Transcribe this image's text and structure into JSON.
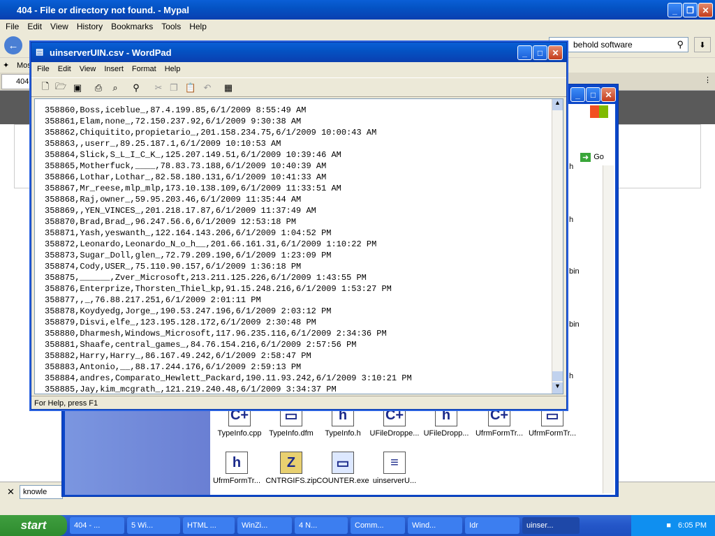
{
  "firefox": {
    "title": "404 - File or directory not found. - Mypal",
    "menu": [
      "File",
      "Edit",
      "View",
      "History",
      "Bookmarks",
      "Tools",
      "Help"
    ],
    "search_value": "behold software",
    "bookmarks_item": "Most",
    "tab_label": "404",
    "find_value": "knowle"
  },
  "explorer": {
    "go_label": "Go",
    "side_labels": [
      "r.h",
      "h",
      "bin",
      "bin",
      "h"
    ],
    "files": [
      {
        "name": "TypeInfo.cpp",
        "icon": "C+"
      },
      {
        "name": "TypeInfo.dfm",
        "icon": "▭"
      },
      {
        "name": "TypeInfo.h",
        "icon": "h"
      },
      {
        "name": "UFileDroppe...",
        "icon": "C+"
      },
      {
        "name": "UFileDropp...",
        "icon": "h"
      },
      {
        "name": "UfrmFormTr...",
        "icon": "C+"
      },
      {
        "name": "UfrmFormTr...",
        "icon": "▭"
      },
      {
        "name": "UfrmFormTr...",
        "icon": "h"
      },
      {
        "name": "CNTRGIFS.zip",
        "icon": "Z"
      },
      {
        "name": "COUNTER.exe",
        "icon": "▭"
      },
      {
        "name": "uinserverU...",
        "icon": "≡"
      }
    ]
  },
  "wordpad": {
    "title": "uinserverUIN.csv - WordPad",
    "menu": [
      "File",
      "Edit",
      "View",
      "Insert",
      "Format",
      "Help"
    ],
    "status": "For Help, press F1",
    "lines": [
      "358860,Boss,iceblue_,87.4.199.85,6/1/2009 8:55:49 AM",
      "358861,Elam,none_,72.150.237.92,6/1/2009 9:30:38 AM",
      "358862,Chiquitito,propietario_,201.158.234.75,6/1/2009 10:00:43 AM",
      "358863,,userr_,89.25.187.1,6/1/2009 10:10:53 AM",
      "358864,Slick,S_L_I_C_K_,125.207.149.51,6/1/2009 10:39:46 AM",
      "358865,Motherfuck,____,78.83.73.188,6/1/2009 10:40:39 AM",
      "358866,Lothar,Lothar_,82.58.180.131,6/1/2009 10:41:33 AM",
      "358867,Mr_reese,mlp_mlp,173.10.138.109,6/1/2009 11:33:51 AM",
      "358868,Raj,owner_,59.95.203.46,6/1/2009 11:35:44 AM",
      "358869,,YEN_VINCES_,201.218.17.87,6/1/2009 11:37:49 AM",
      "358870,Brad,Brad_,96.247.56.6,6/1/2009 12:53:18 PM",
      "358871,Yash,yeswanth_,122.164.143.206,6/1/2009 1:04:52 PM",
      "358872,Leonardo,Leonardo_N_o_h__,201.66.161.31,6/1/2009 1:10:22 PM",
      "358873,Sugar_Doll,glen_,72.79.209.190,6/1/2009 1:23:09 PM",
      "358874,Cody,USER_,75.110.90.157,6/1/2009 1:36:18 PM",
      "358875,______,Zver_Microsoft,213.211.125.226,6/1/2009 1:43:55 PM",
      "358876,Enterprize,Thorsten_Thiel_kp,91.15.248.216,6/1/2009 1:53:27 PM",
      "358877,,_,76.88.217.251,6/1/2009 2:01:11 PM",
      "358878,Koydyedg,Jorge_,190.53.247.196,6/1/2009 2:03:12 PM",
      "358879,Disvi,elfe_,123.195.128.172,6/1/2009 2:30:48 PM",
      "358880,Dharmesh,Windows_Microsoft,117.96.235.116,6/1/2009 2:34:36 PM",
      "358881,Shaafe,central_games_,84.76.154.216,6/1/2009 2:57:56 PM",
      "358882,Harry,Harry_,86.167.49.242,6/1/2009 2:58:47 PM",
      "358883,Antonio,__,88.17.244.176,6/1/2009 2:59:13 PM",
      "358884,andres,Comparato_Hewlett_Packard,190.11.93.242,6/1/2009 3:10:21 PM",
      "358885,Jay,kim_mcgrath_,121.219.240.48,6/1/2009 3:34:37 PM"
    ]
  },
  "taskbar": {
    "start": "start",
    "tasks": [
      "404 - ...",
      "5 Wi...",
      "HTML ...",
      "WinZi...",
      "4 N...",
      "Comm...",
      "Wind...",
      "Idr",
      "uinser..."
    ],
    "clock": "6:05 PM"
  }
}
